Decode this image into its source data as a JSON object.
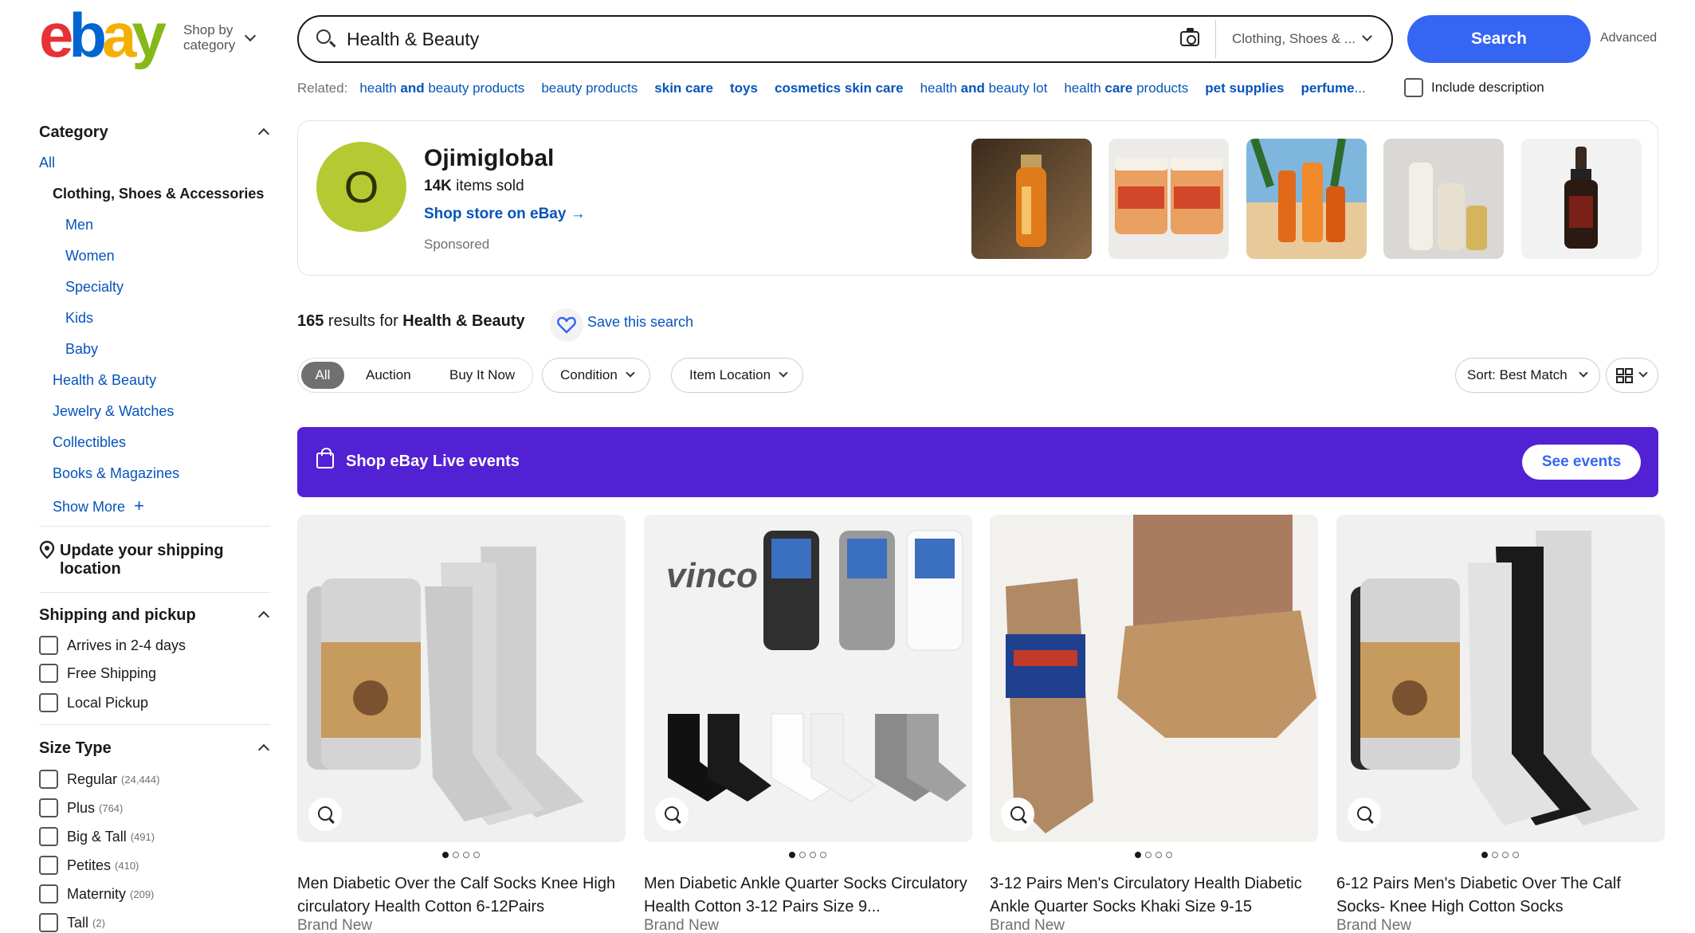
{
  "header": {
    "logo": [
      "e",
      "b",
      "a",
      "y"
    ],
    "logo_colors": [
      "#e53238",
      "#0064d2",
      "#f5af02",
      "#86b817"
    ],
    "shop_by_line1": "Shop by",
    "shop_by_line2": "category",
    "search_value": "Health & Beauty",
    "category_select": "Clothing, Shoes & ...",
    "search_button": "Search",
    "advanced": "Advanced"
  },
  "related": {
    "label": "Related:",
    "links": [
      {
        "pre": "health ",
        "bold": "and",
        "post": " beauty products"
      },
      {
        "pre": "beauty products",
        "bold": "",
        "post": ""
      },
      {
        "pre": "",
        "bold": "skin care",
        "post": ""
      },
      {
        "pre": "",
        "bold": "toys",
        "post": ""
      },
      {
        "pre": "",
        "bold": "cosmetics skin care",
        "post": ""
      },
      {
        "pre": "health ",
        "bold": "and",
        "post": " beauty lot"
      },
      {
        "pre": "health ",
        "bold": "care",
        "post": " products"
      },
      {
        "pre": "",
        "bold": "pet supplies",
        "post": ""
      },
      {
        "pre": "",
        "bold": "perfume",
        "post": "..."
      }
    ],
    "include_description": "Include description"
  },
  "sidebar": {
    "category_heading": "Category",
    "all": "All",
    "current": "Clothing, Shoes & Accessories",
    "sub": [
      "Men",
      "Women",
      "Specialty",
      "Kids",
      "Baby"
    ],
    "other": [
      "Health & Beauty",
      "Jewelry & Watches",
      "Collectibles",
      "Books & Magazines"
    ],
    "show_more": "Show More",
    "shipping_location_line1": "Update your shipping",
    "shipping_location_line2": "location",
    "shipping_heading": "Shipping and pickup",
    "shipping_options": [
      "Arrives in 2-4 days",
      "Free Shipping",
      "Local Pickup"
    ],
    "size_heading": "Size Type",
    "size_options": [
      {
        "label": "Regular",
        "count": "(24,444)"
      },
      {
        "label": "Plus",
        "count": "(764)"
      },
      {
        "label": "Big & Tall",
        "count": "(491)"
      },
      {
        "label": "Petites",
        "count": "(410)"
      },
      {
        "label": "Maternity",
        "count": "(209)"
      },
      {
        "label": "Tall",
        "count": "(2)"
      }
    ]
  },
  "store": {
    "initial": "O",
    "name": "Ojimiglobal",
    "sold_count": "14K",
    "sold_label": " items sold",
    "link": "Shop store on eBay",
    "sponsored": "Sponsored",
    "thumbs": [
      "orange-bottle",
      "papaya-jars",
      "beach-bottles",
      "white-bottles",
      "dropper-bottle"
    ]
  },
  "results": {
    "count": "165",
    "prefix": " results for ",
    "query": "Health & Beauty",
    "save": "Save this search"
  },
  "filters": {
    "all": "All",
    "auction": "Auction",
    "buy_now": "Buy It Now",
    "condition": "Condition",
    "location": "Item Location",
    "sort": "Sort: Best Match"
  },
  "live": {
    "text": "Shop eBay Live events",
    "button": "See events",
    "color": "#5321d4"
  },
  "products": [
    {
      "title": "Men Diabetic Over the Calf Socks Knee High circulatory Health Cotton 6-12Pairs",
      "condition": "Brand New"
    },
    {
      "title": "Men Diabetic Ankle Quarter Socks Circulatory Health Cotton 3-12 Pairs Size 9...",
      "condition": "Brand New",
      "brand_mark": "vinco"
    },
    {
      "title": "3-12 Pairs Men's Circulatory Health Diabetic Ankle Quarter Socks Khaki Size 9-15",
      "condition": "Brand New"
    },
    {
      "title": "6-12 Pairs Men's Diabetic Over The Calf Socks- Knee High Cotton Socks",
      "condition": "Brand New"
    }
  ]
}
